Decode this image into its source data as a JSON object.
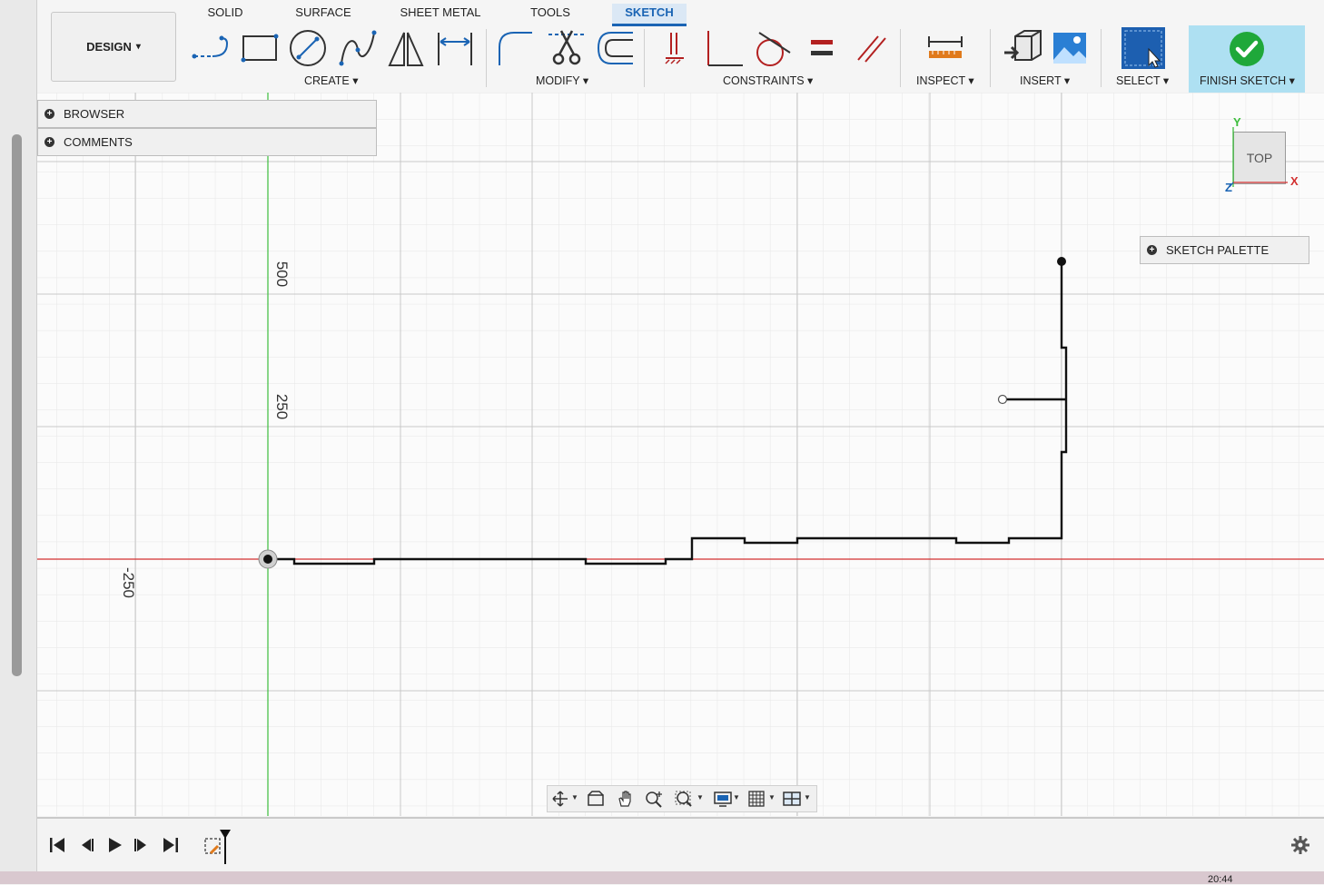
{
  "workspace": {
    "name": "DESIGN",
    "dropdown": "▾"
  },
  "tabs": [
    {
      "label": "SOLID"
    },
    {
      "label": "SURFACE"
    },
    {
      "label": "SHEET METAL"
    },
    {
      "label": "TOOLS"
    },
    {
      "label": "SKETCH",
      "active": true
    }
  ],
  "groups": {
    "create": "CREATE ▾",
    "modify": "MODIFY ▾",
    "constraints": "CONSTRAINTS ▾",
    "inspect": "INSPECT ▾",
    "insert": "INSERT ▾",
    "select": "SELECT ▾",
    "finish": "FINISH SKETCH ▾"
  },
  "panels": {
    "browser": "BROWSER",
    "comments": "COMMENTS",
    "sketch_palette": "SKETCH PALETTE"
  },
  "viewcube": {
    "face": "TOP",
    "x": "X",
    "y": "Y",
    "z": "Z"
  },
  "grid_labels": {
    "v500": "500",
    "v250": "250",
    "h_neg250": "-250"
  },
  "clock": "20:44",
  "colors": {
    "accent": "#1a64b4",
    "finish_bg": "#aee0f2",
    "x_axis": "#d23030",
    "y_axis": "#3cbd3c",
    "check": "#1fa83a"
  }
}
